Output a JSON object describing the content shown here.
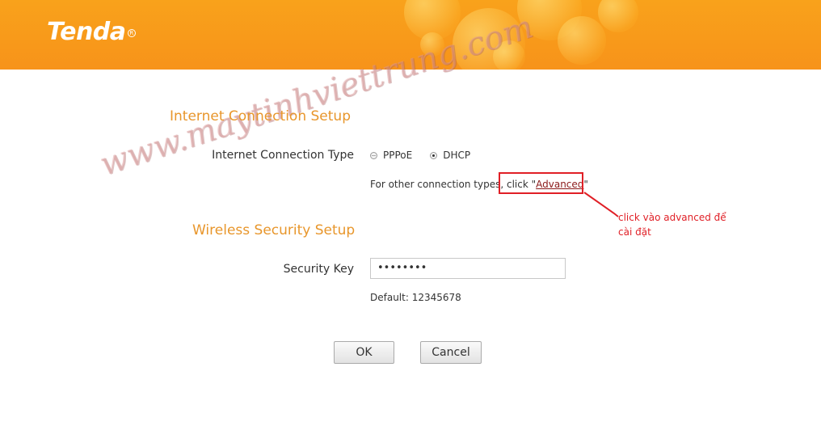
{
  "header": {
    "logo_text": "Tenda",
    "logo_reg": "R",
    "background_color": "#f7931a"
  },
  "internet_section": {
    "title": "Internet Connection Setup",
    "type_label": "Internet Connection Type",
    "options": [
      {
        "label": "PPPoE",
        "selected": false
      },
      {
        "label": "DHCP",
        "selected": true
      }
    ],
    "hint_prefix": "For other connection types, click \"",
    "advanced_link": "Advanced",
    "hint_suffix": "\""
  },
  "wireless_section": {
    "title": "Wireless Security Setup",
    "key_label": "Security Key",
    "key_value": "••••••••",
    "default_text": "Default: 12345678"
  },
  "buttons": {
    "ok": "OK",
    "cancel": "Cancel"
  },
  "annotation": {
    "text": "click vào advanced để cài đặt",
    "color": "#e01f26"
  },
  "watermark": "www.maytinhviettrung.com"
}
